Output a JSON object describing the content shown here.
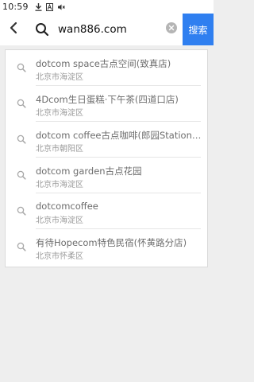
{
  "status_bar": {
    "time": "10:59",
    "icons": [
      "download-icon",
      "a-letter-icon",
      "mute-icon"
    ]
  },
  "search": {
    "query": "wan886.com",
    "button_label": "搜索"
  },
  "suggestions": [
    {
      "title": "dotcom space古点空间(致真店)",
      "subtitle": "北京市海淀区"
    },
    {
      "title": "4Dcom生日蛋糕·下午茶(四道口店)",
      "subtitle": "北京市海淀区"
    },
    {
      "title": "dotcom coffee古点咖啡(郎园Station…",
      "subtitle": "北京市朝阳区"
    },
    {
      "title": "dotcom garden古点花园",
      "subtitle": "北京市海淀区"
    },
    {
      "title": "dotcomcoffee",
      "subtitle": "北京市海淀区"
    },
    {
      "title": "有待Hopecom特色民宿(怀黄路分店)",
      "subtitle": "北京市怀柔区"
    }
  ],
  "colors": {
    "accent": "#2f7ff0",
    "background": "#eeeeee"
  }
}
